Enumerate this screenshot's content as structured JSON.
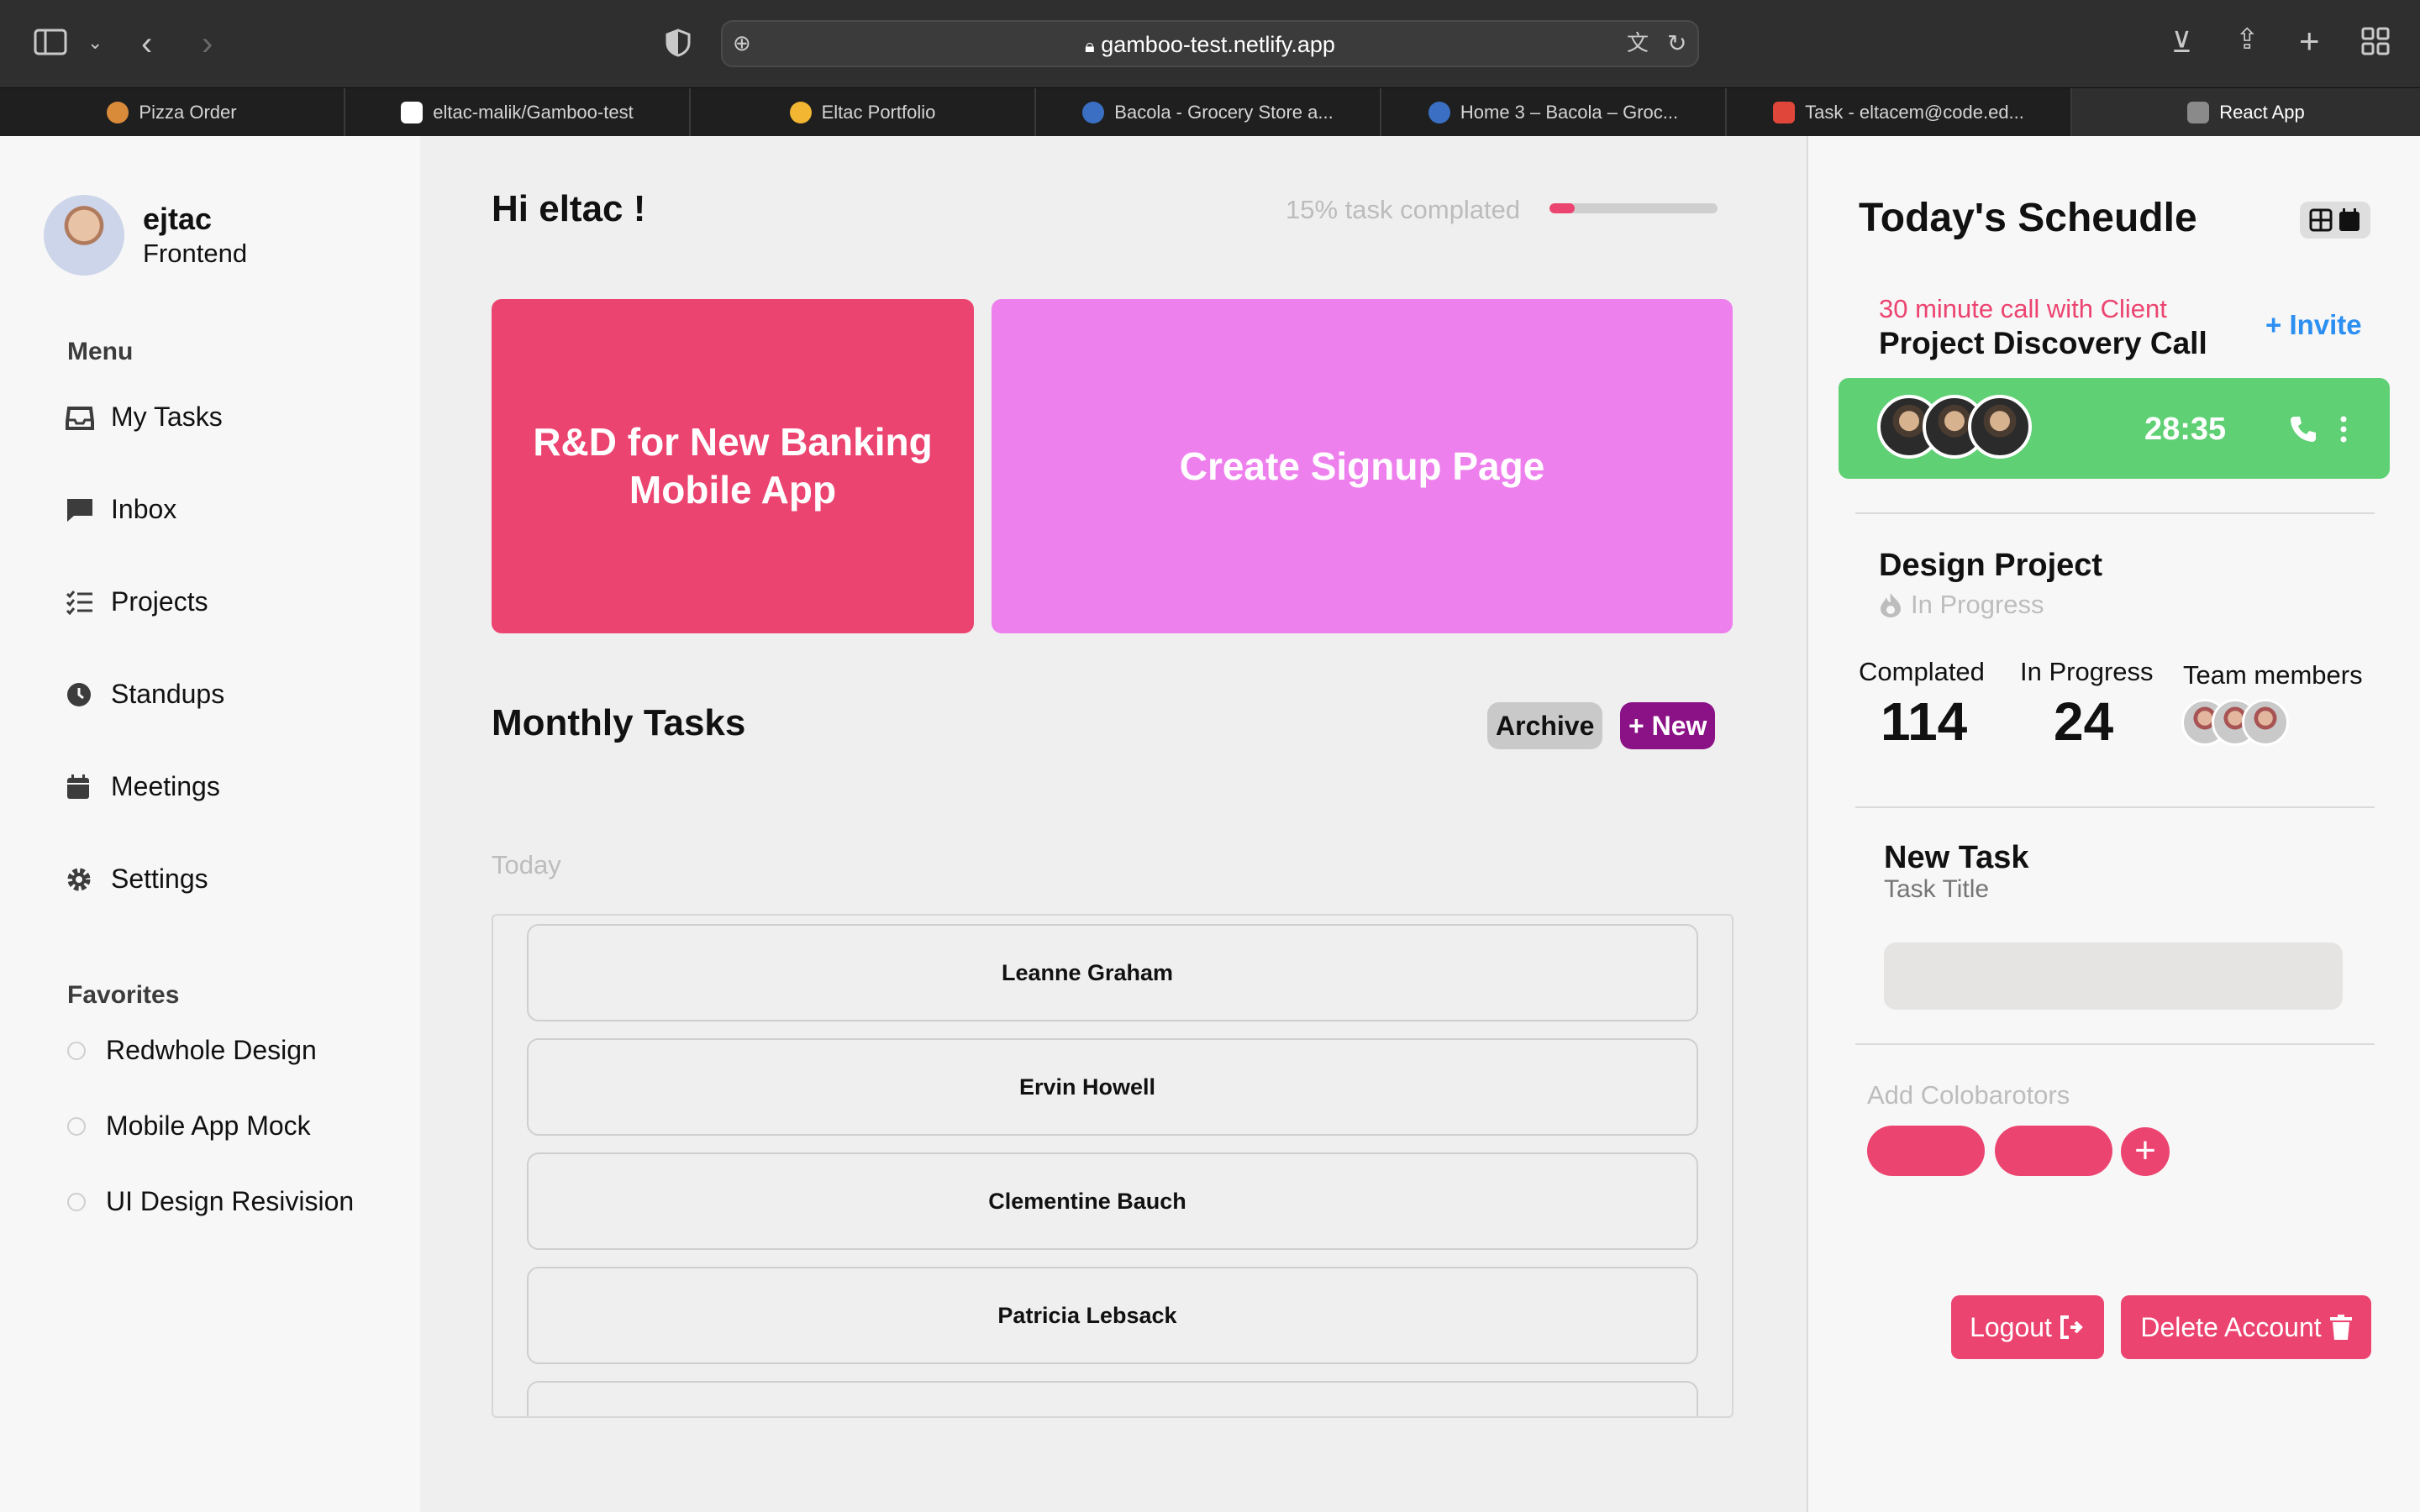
{
  "browser": {
    "url": "gamboo-test.netlify.app",
    "tabs": [
      {
        "label": "Pizza Order"
      },
      {
        "label": "eltac-malik/Gamboo-test"
      },
      {
        "label": "Eltac Portfolio"
      },
      {
        "label": "Bacola - Grocery Store a..."
      },
      {
        "label": "Home 3 – Bacola – Groc..."
      },
      {
        "label": "Task - eltacem@code.ed..."
      },
      {
        "label": "React App"
      }
    ]
  },
  "sidebar": {
    "user": {
      "name": "ejtac",
      "role": "Frontend"
    },
    "menu_heading": "Menu",
    "menu": [
      {
        "label": "My Tasks",
        "icon": "inbox-tray-icon"
      },
      {
        "label": "Inbox",
        "icon": "chat-bubble-icon"
      },
      {
        "label": "Projects",
        "icon": "checklist-icon"
      },
      {
        "label": "Standups",
        "icon": "clock-icon"
      },
      {
        "label": "Meetings",
        "icon": "calendar-icon"
      },
      {
        "label": "Settings",
        "icon": "gear-icon"
      }
    ],
    "favorites_heading": "Favorites",
    "favorites": [
      {
        "label": "Redwhole Design"
      },
      {
        "label": "Mobile App Mock"
      },
      {
        "label": "UI Design Resivision"
      }
    ]
  },
  "main": {
    "greeting": "Hi eltac !",
    "progress": {
      "label": "15% task complated",
      "percent": 15
    },
    "cards": [
      {
        "title": "R&D for New Banking Mobile App",
        "color": "#ec4470"
      },
      {
        "title": "Create Signup Page",
        "color": "#ee80ee"
      }
    ],
    "monthly_title": "Monthly Tasks",
    "archive_label": "Archive",
    "new_label": "+ New",
    "today_label": "Today",
    "tasks": [
      {
        "name": "Leanne Graham"
      },
      {
        "name": "Ervin Howell"
      },
      {
        "name": "Clementine Bauch"
      },
      {
        "name": "Patricia Lebsack"
      }
    ]
  },
  "schedule": {
    "title": "Today's Scheudle",
    "call": {
      "subtitle": "30 minute call with Client",
      "title": "Project Discovery Call",
      "invite_label": "+ Invite",
      "timer": "28:35"
    },
    "project": {
      "title": "Design Project",
      "status": "In Progress",
      "stats": [
        {
          "label": "Complated",
          "value": "114"
        },
        {
          "label": "In Progress",
          "value": "24"
        }
      ],
      "team_label": "Team members"
    },
    "new_task": {
      "title": "New Task",
      "placeholder": "Task Title"
    },
    "collaborators_label": "Add Colobarotors",
    "logout_label": "Logout",
    "delete_label": "Delete Account"
  },
  "colors": {
    "accent": "#ec4470",
    "secondary": "#ee80ee",
    "purple": "#8b1187",
    "green": "#5fd074",
    "link": "#2c8ff2"
  }
}
